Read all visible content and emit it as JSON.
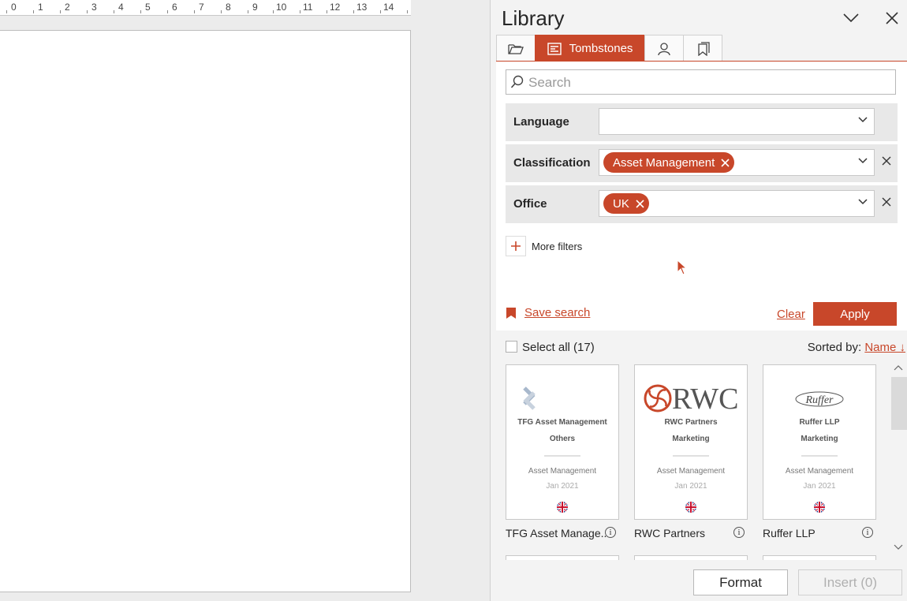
{
  "ruler": {
    "numbers": [
      "0",
      "1",
      "2",
      "3",
      "4",
      "5",
      "6",
      "7",
      "8",
      "9",
      "10",
      "11",
      "12",
      "13",
      "14"
    ]
  },
  "panel": {
    "title": "Library",
    "tabs": {
      "active_label": "Tombstones"
    },
    "search": {
      "placeholder": "Search"
    },
    "filters": [
      {
        "label": "Language",
        "chip": ""
      },
      {
        "label": "Classification",
        "chip": "Asset Management"
      },
      {
        "label": "Office",
        "chip": "UK"
      }
    ],
    "more_filters": "More filters",
    "save_search": "Save search",
    "clear": "Clear",
    "apply": "Apply"
  },
  "results": {
    "select_all": "Select all (17)",
    "sorted_by": "Sorted by:",
    "sort_field": "Name ↓",
    "cards": [
      {
        "line1": "TFG Asset Management",
        "line2": "Others",
        "line3": "Asset Management",
        "line4": "Jan 2021",
        "name": "TFG Asset Manage..",
        "logo": "tfg-logo"
      },
      {
        "line1": "RWC Partners",
        "line2": "Marketing",
        "line3": "Asset Management",
        "line4": "Jan 2021",
        "name": "RWC Partners",
        "logo": "rwc-logo",
        "logo_text": "RWC"
      },
      {
        "line1": "Ruffer LLP",
        "line2": "Marketing",
        "line3": "Asset Management",
        "line4": "Jan 2021",
        "name": "Ruffer LLP",
        "logo": "ruffer-logo",
        "logo_text": "Ruffer"
      }
    ]
  },
  "footer": {
    "format": "Format",
    "insert": "Insert (0)"
  },
  "colors": {
    "accent": "#c8472a",
    "panel_bg": "#f3f3f3",
    "filter_row_bg": "#e8e8e8"
  }
}
